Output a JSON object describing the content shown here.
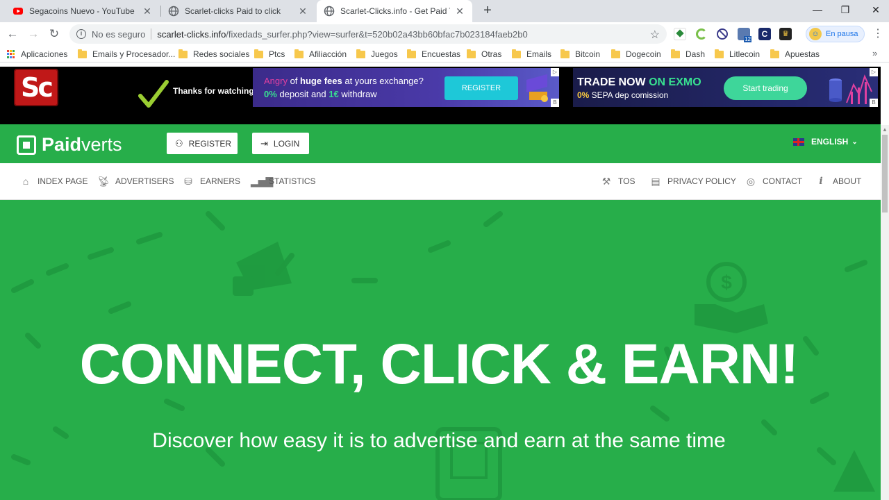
{
  "browser": {
    "tabs": [
      {
        "title": "Segacoins Nuevo - YouTube",
        "icon": "youtube-icon"
      },
      {
        "title": "Scarlet-clicks Paid to click",
        "icon": "globe-icon"
      },
      {
        "title": "Scarlet-Clicks.info - Get Paid To Click",
        "icon": "globe-icon"
      }
    ],
    "address": {
      "security": "No es seguro",
      "domain": "scarlet-clicks.info",
      "path": "/fixedads_surfer.php?view=surfer&t=520b02a43bb60bfac7b023184faeb2b0"
    },
    "profile_label": "En pausa",
    "bookmarks": [
      "Aplicaciones",
      "Emails y Procesador...",
      "Redes sociales",
      "Ptcs",
      "Afiliacción",
      "Juegos",
      "Encuestas",
      "Otras",
      "Emails",
      "Bitcoin",
      "Dogecoin",
      "Dash",
      "Litlecoin",
      "Apuestas"
    ]
  },
  "surfbar": {
    "logo": "Sc",
    "thanks": "Thanks for watching!",
    "ad1": {
      "angry": "Angry",
      "of": " of ",
      "huge": "huge fees",
      "rest": " at yours exchange?",
      "pct": "0%",
      "deposit": " deposit and ",
      "euro": "1€",
      "withdraw": " withdraw",
      "button": "REGISTER"
    },
    "ad2": {
      "trade": "TRADE NOW ",
      "exmo": "ON EXMO",
      "pct": "0%",
      "sepa": " SEPA dep comission",
      "button": "Start trading"
    }
  },
  "site": {
    "logo_bold": "Paid",
    "logo_thin": "verts",
    "register": "REGISTER",
    "login": "LOGIN",
    "language": "ENGLISH",
    "nav_left": [
      "INDEX PAGE",
      "ADVERTISERS",
      "EARNERS",
      "STATISTICS"
    ],
    "nav_right": [
      "TOS",
      "PRIVACY POLICY",
      "CONTACT",
      "ABOUT"
    ],
    "hero_title": "CONNECT, CLICK & EARN!",
    "hero_subtitle": "Discover how easy it is to advertise and earn at the same time"
  },
  "colors": {
    "brand_green": "#27ae4a",
    "scarlet_red": "#c01818"
  }
}
